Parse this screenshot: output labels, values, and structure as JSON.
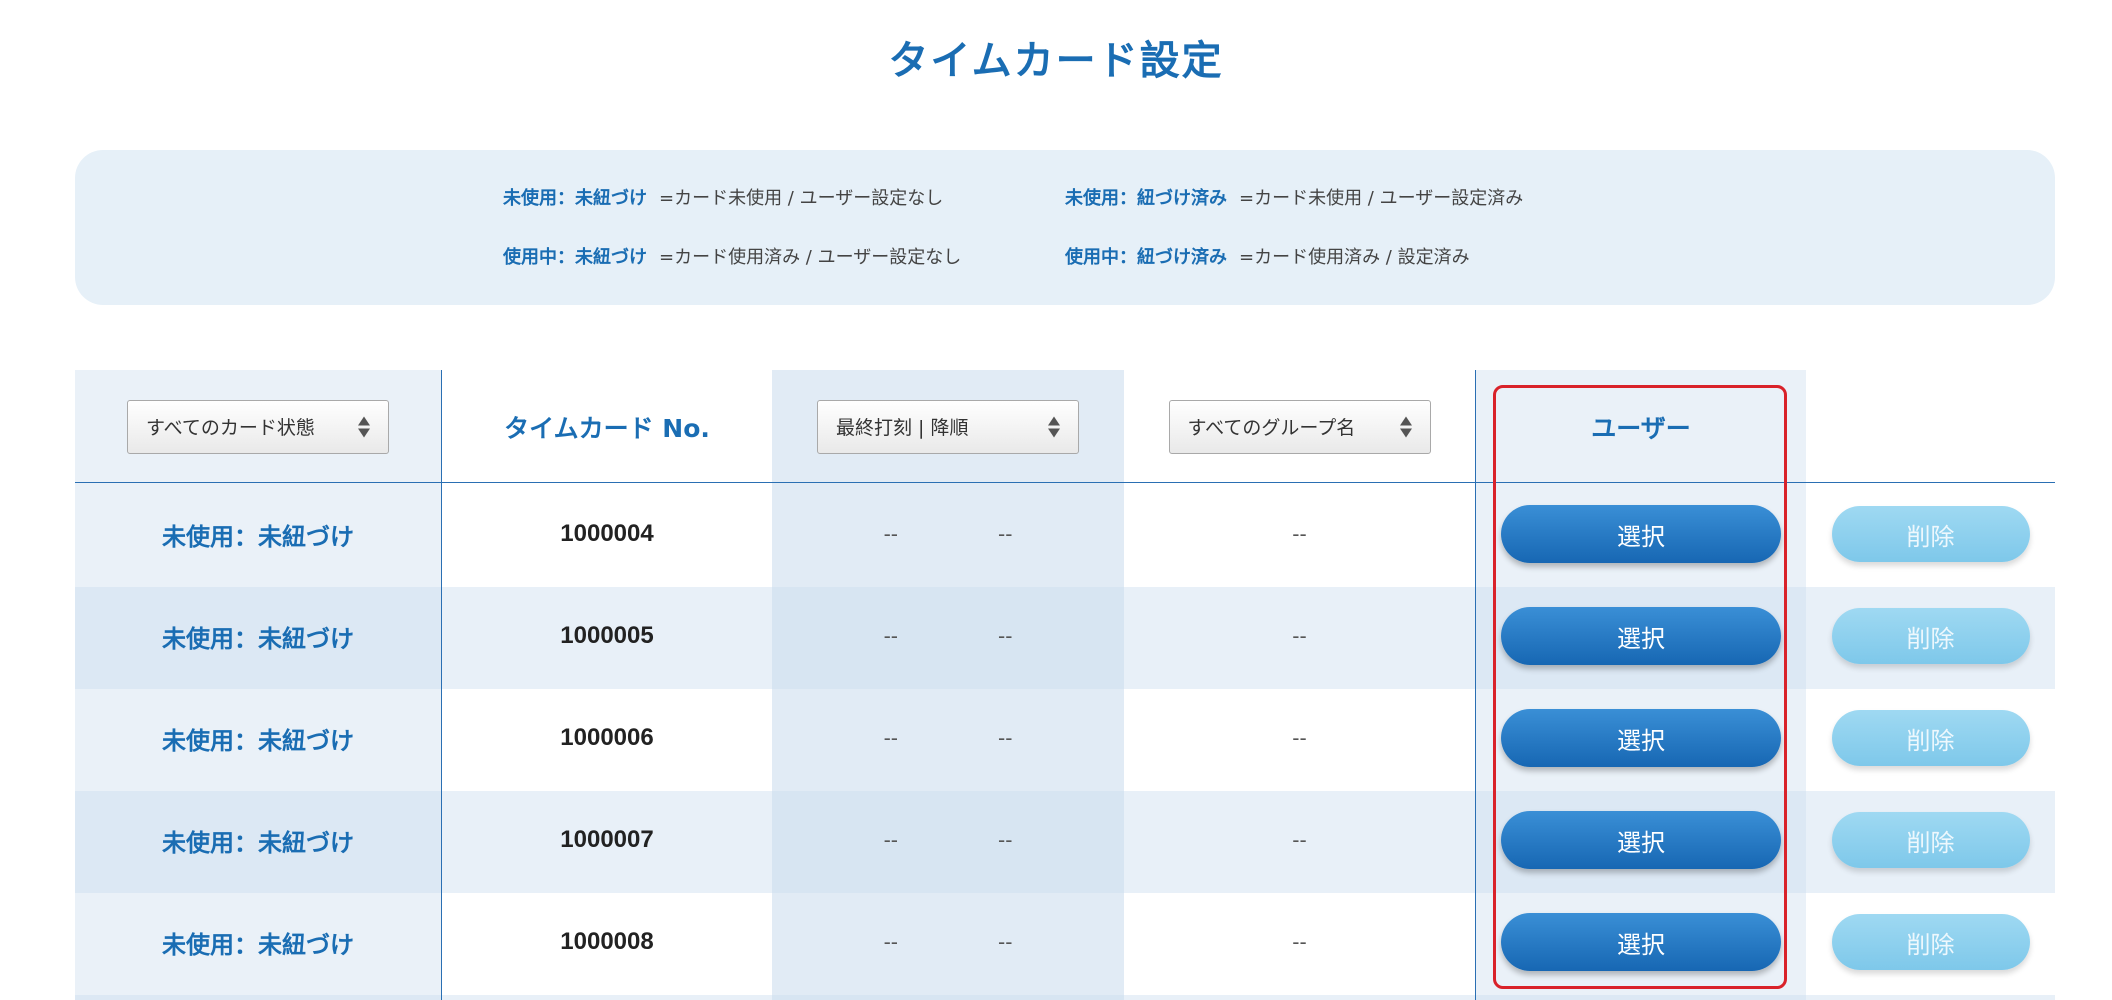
{
  "page": {
    "title": "タイムカード設定"
  },
  "legend": [
    {
      "key": "未使用：未紐づけ",
      "desc": "=カード未使用 / ユーザー設定なし"
    },
    {
      "key": "未使用：紐づけ済み",
      "desc": "=カード未使用 / ユーザー設定済み"
    },
    {
      "key": "使用中：未紐づけ",
      "desc": "=カード使用済み / ユーザー設定なし"
    },
    {
      "key": "使用中：紐づけ済み",
      "desc": "=カード使用済み / 設定済み"
    }
  ],
  "header": {
    "status_filter": "すべてのカード状態",
    "card_no": "タイムカード No.",
    "sort_select": "最終打刻 | 降順",
    "group_filter": "すべてのグループ名",
    "user": "ユーザー"
  },
  "rows": [
    {
      "status": "未使用：未紐づけ",
      "card_no": "1000004",
      "last1": "--",
      "last2": "--",
      "group": "--",
      "select": "選択",
      "delete": "削除"
    },
    {
      "status": "未使用：未紐づけ",
      "card_no": "1000005",
      "last1": "--",
      "last2": "--",
      "group": "--",
      "select": "選択",
      "delete": "削除"
    },
    {
      "status": "未使用：未紐づけ",
      "card_no": "1000006",
      "last1": "--",
      "last2": "--",
      "group": "--",
      "select": "選択",
      "delete": "削除"
    },
    {
      "status": "未使用：未紐づけ",
      "card_no": "1000007",
      "last1": "--",
      "last2": "--",
      "group": "--",
      "select": "選択",
      "delete": "削除"
    },
    {
      "status": "未使用：未紐づけ",
      "card_no": "1000008",
      "last1": "--",
      "last2": "--",
      "group": "--",
      "select": "選択",
      "delete": "削除"
    }
  ],
  "colors": {
    "accent": "#1a6db3",
    "legend_bg": "#e6f0f8",
    "select_button": "#1f77c4",
    "delete_button": "#8fd0ee",
    "highlight": "#d9222a"
  }
}
